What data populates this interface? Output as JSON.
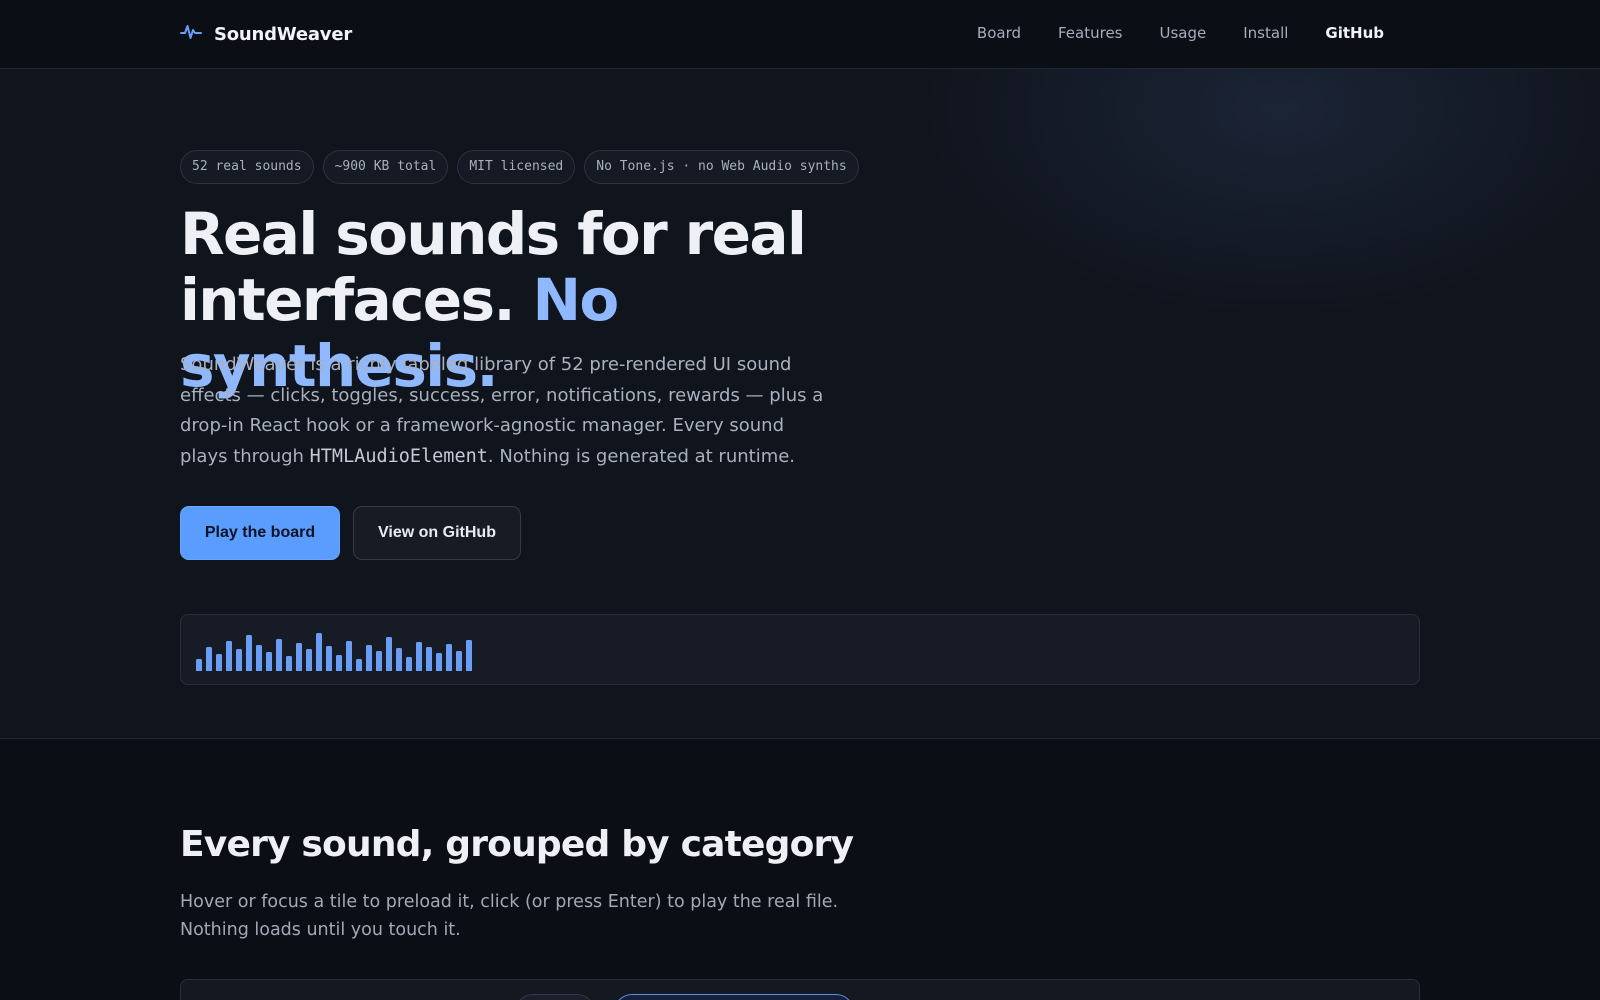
{
  "nav": {
    "brand": "SoundWeaver",
    "links": [
      "Board",
      "Features",
      "Usage",
      "Install",
      "GitHub"
    ]
  },
  "hero": {
    "pills": [
      "52 real sounds",
      "~900 KB total",
      "MIT licensed",
      "No Tone.js · no Web Audio synths"
    ],
    "headline_main": "Real sounds for real interfaces.",
    "headline_accent": "No synthesis.",
    "lede_before_code": "SoundWeaver is a richly labeled library of 52 pre-rendered UI sound effects — clicks, toggles, success, error, notifications, rewards — plus a drop-in React hook or a framework-agnostic manager. Every sound plays through ",
    "lede_code": "HTMLAudioElement",
    "lede_after_code": ". Nothing is generated at runtime.",
    "primary_button": "Play the board",
    "secondary_button": "View on GitHub",
    "waveform_levels": [
      0.3,
      0.6,
      0.42,
      0.75,
      0.55,
      0.9,
      0.65,
      0.48,
      0.8,
      0.38,
      0.7,
      0.55,
      0.95,
      0.62,
      0.4,
      0.75,
      0.3,
      0.65,
      0.5,
      0.85,
      0.58,
      0.35,
      0.72,
      0.6,
      0.45,
      0.68,
      0.5,
      0.78
    ]
  },
  "board_section": {
    "title": "Every sound, grouped by category",
    "subtitle": "Hover or focus a tile to preload it, click (or press Enter) to play the real file. Nothing loads until you touch it."
  },
  "colors": {
    "accent": "#8fb8ff",
    "primary_button": "#5b9cff",
    "waveform": "#6a9ef5",
    "background": "#0b0e14"
  }
}
